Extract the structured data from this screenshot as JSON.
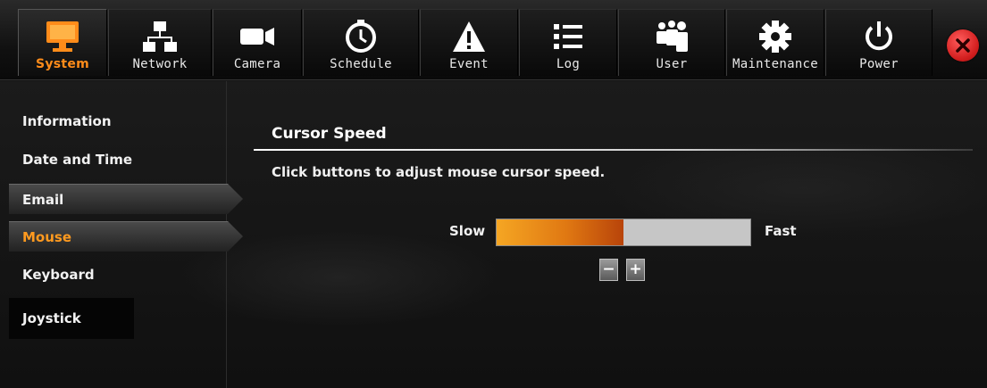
{
  "nav": {
    "tabs": [
      {
        "label": "System",
        "icon": "monitor-icon"
      },
      {
        "label": "Network",
        "icon": "network-icon"
      },
      {
        "label": "Camera",
        "icon": "camera-icon"
      },
      {
        "label": "Schedule",
        "icon": "clock-icon"
      },
      {
        "label": "Event",
        "icon": "warning-icon"
      },
      {
        "label": "Log",
        "icon": "list-icon"
      },
      {
        "label": "User",
        "icon": "users-icon"
      },
      {
        "label": "Maintenance",
        "icon": "gear-icon"
      },
      {
        "label": "Power",
        "icon": "power-icon"
      }
    ],
    "active": "System",
    "close_icon": "close-icon"
  },
  "sidebar": {
    "items": [
      {
        "label": "Information"
      },
      {
        "label": "Date and Time"
      },
      {
        "label": "Email"
      },
      {
        "label": "Mouse"
      },
      {
        "label": "Keyboard"
      },
      {
        "label": "Joystick"
      }
    ],
    "active": "Mouse"
  },
  "main": {
    "title": "Cursor Speed",
    "description": "Click buttons to adjust mouse cursor speed.",
    "slider": {
      "min_label": "Slow",
      "max_label": "Fast",
      "value_fraction": 0.5
    },
    "decrease_label": "−",
    "increase_label": "+"
  },
  "colors": {
    "accent": "#ff9a1f",
    "slider_fill_start": "#f5a623",
    "slider_fill_end": "#b8440a",
    "slider_track": "#c6c6c6",
    "close": "#d21e1e"
  }
}
